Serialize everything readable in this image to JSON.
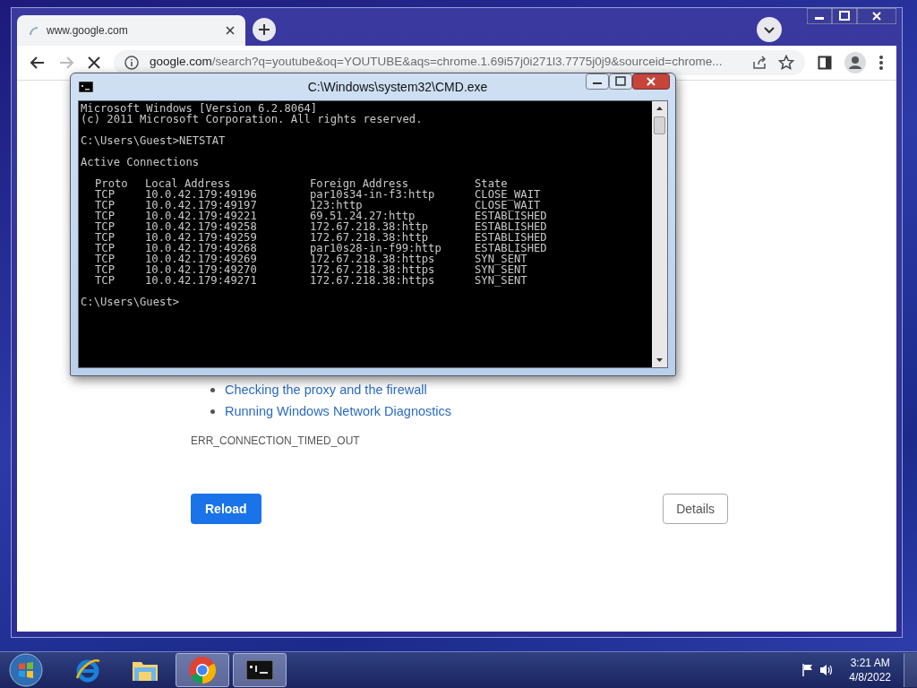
{
  "browser": {
    "tab": {
      "title": "www.google.com",
      "loading": true
    },
    "address": {
      "host": "google.com",
      "path": "/search?q=youtube&oq=YOUTUBE&aqs=chrome.1.69i57j0i271l3.7775j0j9&sourceid=chrome..."
    },
    "forward_disabled": true
  },
  "page": {
    "links": [
      "Checking the proxy and the firewall",
      "Running Windows Network Diagnostics"
    ],
    "error_code": "ERR_CONNECTION_TIMED_OUT",
    "buttons": [
      {
        "label": "Reload",
        "kind": "primary"
      },
      {
        "label": "Details",
        "kind": "secondary"
      }
    ]
  },
  "cmd": {
    "title": "C:\\Windows\\system32\\CMD.exe",
    "banner": [
      "Microsoft Windows [Version 6.2.8064]",
      "(c) 2011 Microsoft Corporation. All rights reserved."
    ],
    "command": "C:\\Users\\Guest>NETSTAT",
    "heading": "Active Connections",
    "columns": [
      "Proto",
      "Local Address",
      "Foreign Address",
      "State"
    ],
    "rows": [
      {
        "proto": "TCP",
        "local": "10.0.42.179:49196",
        "foreign": "par10s34-in-f3:http",
        "state": "CLOSE_WAIT"
      },
      {
        "proto": "TCP",
        "local": "10.0.42.179:49197",
        "foreign": "123:http",
        "state": "CLOSE_WAIT"
      },
      {
        "proto": "TCP",
        "local": "10.0.42.179:49221",
        "foreign": "69.51.24.27:http",
        "state": "ESTABLISHED"
      },
      {
        "proto": "TCP",
        "local": "10.0.42.179:49258",
        "foreign": "172.67.218.38:http",
        "state": "ESTABLISHED"
      },
      {
        "proto": "TCP",
        "local": "10.0.42.179:49259",
        "foreign": "172.67.218.38:http",
        "state": "ESTABLISHED"
      },
      {
        "proto": "TCP",
        "local": "10.0.42.179:49268",
        "foreign": "par10s28-in-f99:http",
        "state": "ESTABLISHED"
      },
      {
        "proto": "TCP",
        "local": "10.0.42.179:49269",
        "foreign": "172.67.218.38:https",
        "state": "SYN_SENT"
      },
      {
        "proto": "TCP",
        "local": "10.0.42.179:49270",
        "foreign": "172.67.218.38:https",
        "state": "SYN_SENT"
      },
      {
        "proto": "TCP",
        "local": "10.0.42.179:49271",
        "foreign": "172.67.218.38:https",
        "state": "SYN_SENT"
      }
    ],
    "prompt": "C:\\Users\\Guest>"
  },
  "taskbar": {
    "items": [
      {
        "kind": "ie",
        "open": false
      },
      {
        "kind": "explorer",
        "open": false
      },
      {
        "kind": "chrome",
        "open": true
      },
      {
        "kind": "cmd",
        "open": true
      }
    ],
    "time": "3:21 AM",
    "date": "4/8/2022"
  }
}
